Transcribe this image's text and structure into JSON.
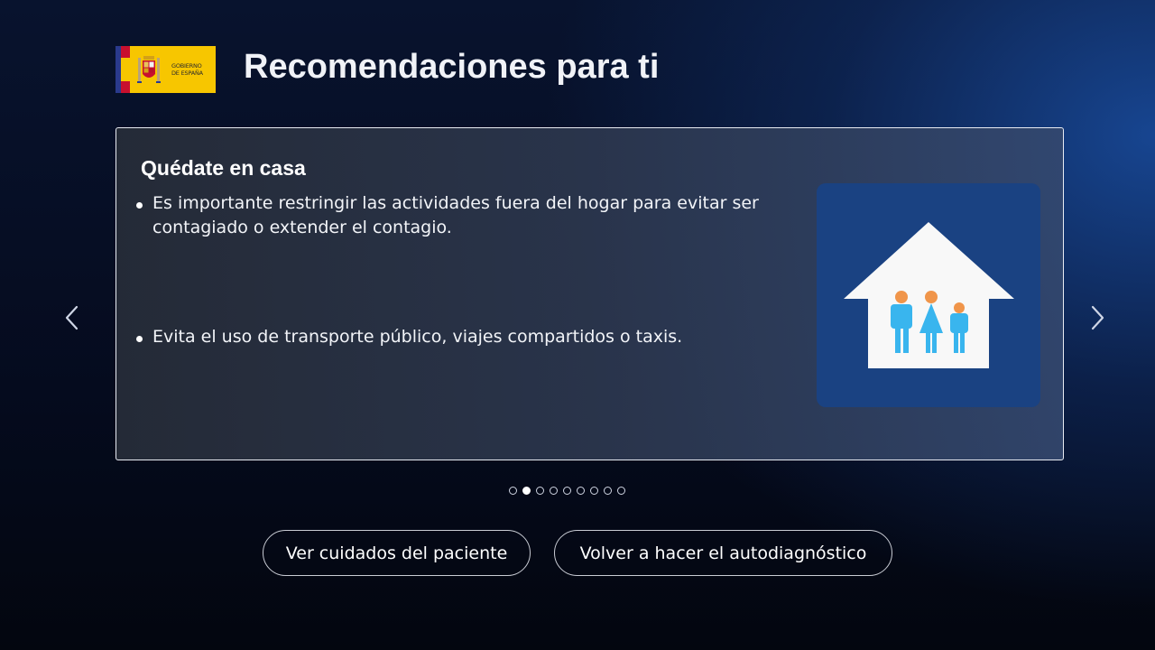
{
  "logo": {
    "lines": [
      "GOBIERNO",
      "DE ESPAÑA"
    ]
  },
  "header": {
    "title": "Recomendaciones para ti"
  },
  "card": {
    "title": "Quédate en casa",
    "bullets": [
      "Es importante restringir las actividades fuera del hogar para evitar ser contagiado o extender el contagio.",
      "Evita el uso de transporte público, viajes compartidos o taxis."
    ],
    "illustration_icon": "house-family-icon"
  },
  "carousel": {
    "total_slides": 9,
    "active_index": 1,
    "prev_icon": "chevron-left-icon",
    "next_icon": "chevron-right-icon"
  },
  "actions": {
    "care_label": "Ver cuidados del paciente",
    "redo_label": "Volver a hacer el autodiagnóstico"
  },
  "colors": {
    "illustration_bg": "#1a4282",
    "person_blue": "#39b5ee",
    "person_head": "#f0954a"
  }
}
